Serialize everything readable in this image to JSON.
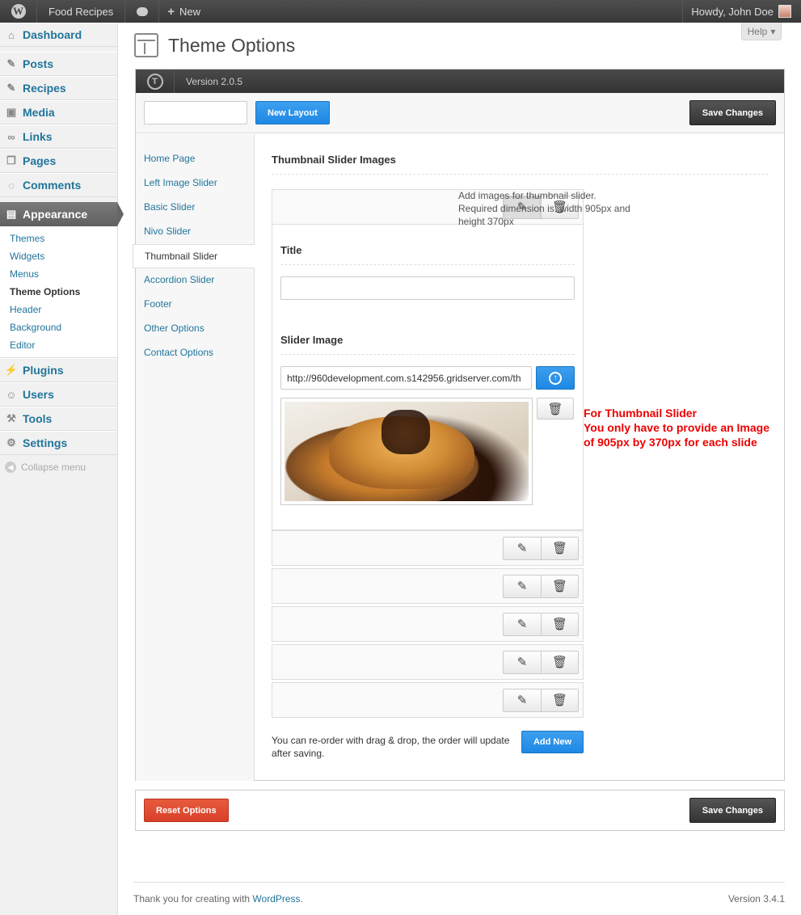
{
  "adminbar": {
    "site_name": "Food Recipes",
    "new_label": "New",
    "howdy": "Howdy, John Doe"
  },
  "sidebar": {
    "items": [
      {
        "label": "Dashboard",
        "icon": "house-icon"
      },
      {
        "label": "Posts",
        "icon": "pin-icon"
      },
      {
        "label": "Recipes",
        "icon": "pin-icon"
      },
      {
        "label": "Media",
        "icon": "media-icon"
      },
      {
        "label": "Links",
        "icon": "link-icon"
      },
      {
        "label": "Pages",
        "icon": "pages-icon"
      },
      {
        "label": "Comments",
        "icon": "comment-icon"
      },
      {
        "label": "Appearance",
        "icon": "appearance-icon"
      },
      {
        "label": "Plugins",
        "icon": "plugin-icon"
      },
      {
        "label": "Users",
        "icon": "users-icon"
      },
      {
        "label": "Tools",
        "icon": "tools-icon"
      },
      {
        "label": "Settings",
        "icon": "settings-icon"
      }
    ],
    "appearance_sub": [
      "Themes",
      "Widgets",
      "Menus",
      "Theme Options",
      "Header",
      "Background",
      "Editor"
    ],
    "collapse": "Collapse menu"
  },
  "page": {
    "title": "Theme Options",
    "help": "Help"
  },
  "panel": {
    "version": "Version 2.0.5",
    "new_layout": "New Layout",
    "save_changes": "Save Changes",
    "reset_options": "Reset Options"
  },
  "nav": [
    "Home Page",
    "Left Image Slider",
    "Basic Slider",
    "Nivo Slider",
    "Thumbnail Slider",
    "Accordion Slider",
    "Footer",
    "Other Options",
    "Contact Options"
  ],
  "content": {
    "section_title": "Thumbnail Slider Images",
    "field_title_label": "Title",
    "field_image_label": "Slider Image",
    "image_url": "http://960development.com.s142956.gridserver.com/th",
    "description": "Add images for thumbnail slider. Required dimension is: width 905px and height 370px",
    "annotation_line1": "For Thumbnail Slider",
    "annotation_line2": "You only have to provide an Image",
    "annotation_line3": "of 905px by 370px for each slide",
    "reorder_note": "You can re-order with drag & drop, the order will update after saving.",
    "add_new": "Add New"
  },
  "footer": {
    "thanks": "Thank you for creating with ",
    "wp_link": "WordPress",
    "thanks_end": ".",
    "version": "Version 3.4.1"
  }
}
